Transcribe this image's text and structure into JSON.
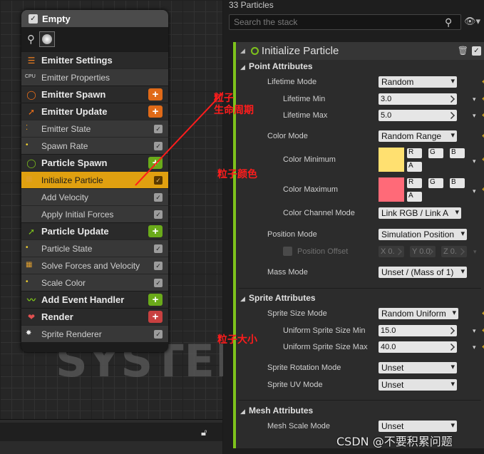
{
  "node": {
    "title": "Empty",
    "sections": [
      {
        "kind": "sec",
        "label": "Emitter Settings",
        "icon": "emitter-settings-icon",
        "color": "#f08020"
      },
      {
        "kind": "row",
        "label": "Emitter Properties",
        "icon": "cpu-icon"
      },
      {
        "kind": "sec",
        "label": "Emitter Spawn",
        "icon": "ring-icon",
        "color": "#f07018",
        "add": "#e06a18"
      },
      {
        "kind": "sec",
        "label": "Emitter Update",
        "icon": "arrow-icon",
        "color": "#f07018",
        "add": "#e06a18"
      },
      {
        "kind": "row",
        "label": "Emitter State",
        "icon": "dots-icon",
        "check": true
      },
      {
        "kind": "row",
        "label": "Spawn Rate",
        "icon": "dot-icon",
        "check": true
      },
      {
        "kind": "sec",
        "label": "Particle Spawn",
        "icon": "ring-icon",
        "color": "#7ec31c",
        "add": "#6aaa1a"
      },
      {
        "kind": "row",
        "label": "Initialize Particle",
        "icon": "grid-icon",
        "check": true,
        "selected": true
      },
      {
        "kind": "row",
        "label": "Add Velocity",
        "icon": "",
        "check": true
      },
      {
        "kind": "row",
        "label": "Apply Initial Forces",
        "icon": "",
        "check": true
      },
      {
        "kind": "sec",
        "label": "Particle Update",
        "icon": "arrow-icon",
        "color": "#7ec31c",
        "add": "#6aaa1a"
      },
      {
        "kind": "row",
        "label": "Particle State",
        "icon": "dot-icon",
        "check": true
      },
      {
        "kind": "row",
        "label": "Solve Forces and Velocity",
        "icon": "grid-icon",
        "check": true
      },
      {
        "kind": "row",
        "label": "Scale Color",
        "icon": "dot-icon",
        "check": true
      },
      {
        "kind": "sec",
        "label": "Add Event Handler",
        "icon": "signal-icon",
        "color": "#7ec31c",
        "add": "#6aaa1a"
      },
      {
        "kind": "sec",
        "label": "Render",
        "icon": "render-icon",
        "color": "#e05050",
        "add": "#c84040"
      },
      {
        "kind": "row",
        "label": "Sprite Renderer",
        "icon": "star-icon",
        "check": true
      }
    ]
  },
  "watermark": "SYSTEM",
  "panel": {
    "title": "33 Particles",
    "search_placeholder": "Search the stack",
    "module_title": "Initialize Particle",
    "point_attributes": "Point Attributes",
    "lifetime_mode_label": "Lifetime Mode",
    "lifetime_mode_value": "Random",
    "lifetime_min_label": "Lifetime Min",
    "lifetime_min_value": "3.0",
    "lifetime_max_label": "Lifetime Max",
    "lifetime_max_value": "5.0",
    "color_mode_label": "Color Mode",
    "color_mode_value": "Random Range",
    "color_min_label": "Color Minimum",
    "color_min_swatch": "#ffe070",
    "color_max_label": "Color Maximum",
    "color_max_swatch": "#ff6a78",
    "chan_r": "R",
    "chan_g": "G",
    "chan_b": "B",
    "chan_a": "A",
    "channel_mode_label": "Color Channel Mode",
    "channel_mode_value": "Link RGB / Link A",
    "position_mode_label": "Position Mode",
    "position_mode_value": "Simulation Position",
    "position_offset_label": "Position Offset",
    "pos_x": "X 0.",
    "pos_y": "Y 0.0",
    "pos_z": "Z 0.",
    "mass_mode_label": "Mass Mode",
    "mass_mode_value": "Unset / (Mass of 1)",
    "sprite_attributes": "Sprite Attributes",
    "sprite_size_mode_label": "Sprite Size Mode",
    "sprite_size_mode_value": "Random Uniform",
    "sprite_size_min_label": "Uniform Sprite Size Min",
    "sprite_size_min_value": "15.0",
    "sprite_size_max_label": "Uniform Sprite Size Max",
    "sprite_size_max_value": "40.0",
    "sprite_rot_label": "Sprite Rotation Mode",
    "sprite_rot_value": "Unset",
    "sprite_uv_label": "Sprite UV Mode",
    "sprite_uv_value": "Unset",
    "mesh_attributes": "Mesh Attributes",
    "mesh_scale_label": "Mesh Scale Mode",
    "mesh_scale_value": "Unset"
  },
  "annotations": {
    "lifetime_line1": "粒子",
    "lifetime_line2": "生命周期",
    "color": "粒子颜色",
    "size": "粒子大小"
  },
  "footer": "CSDN @不要积累问题"
}
